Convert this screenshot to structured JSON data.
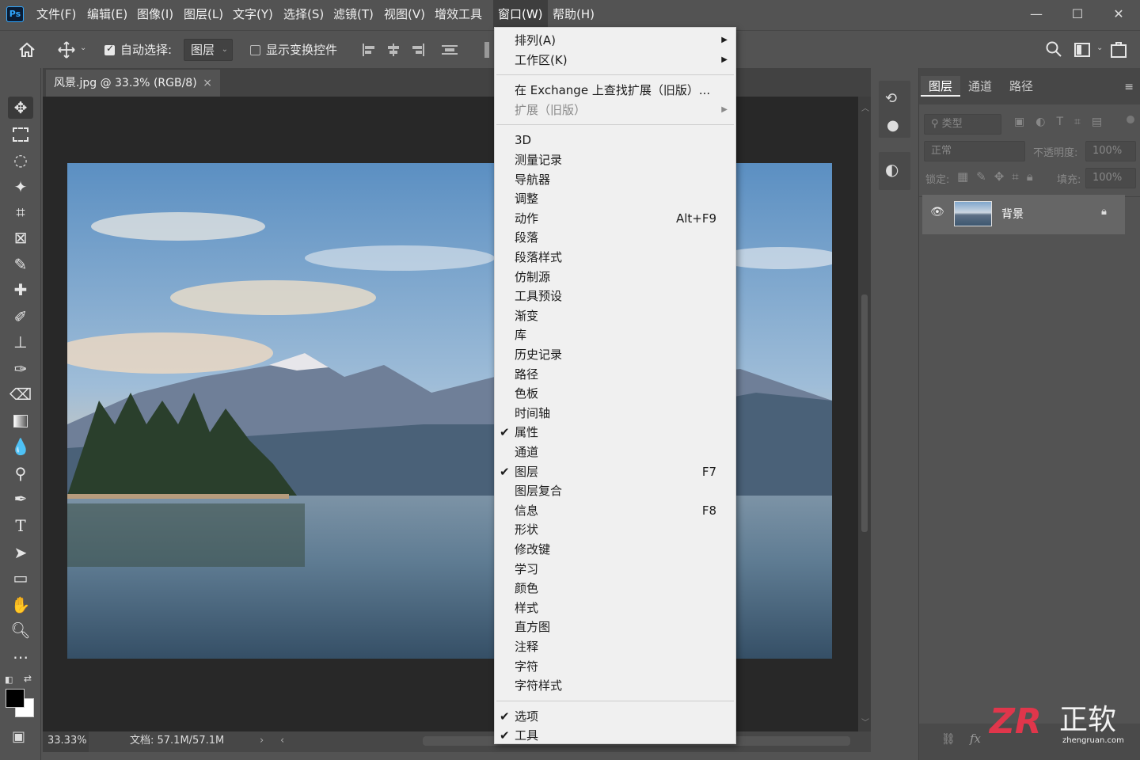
{
  "app": {
    "logo": "Ps"
  },
  "menubar": {
    "items": [
      "文件(F)",
      "编辑(E)",
      "图像(I)",
      "图层(L)",
      "文字(Y)",
      "选择(S)",
      "滤镜(T)",
      "视图(V)",
      "增效工具",
      "窗口(W)",
      "帮助(H)"
    ],
    "active_index": 9
  },
  "window_controls": {
    "minimize": "—",
    "maximize": "☐",
    "close": "✕"
  },
  "options": {
    "auto_select_label": "自动选择:",
    "auto_select_checked": true,
    "auto_select_target": "图层",
    "show_transform_label": "显示变换控件",
    "show_transform_checked": false
  },
  "document": {
    "tab_title": "风景.jpg @ 33.3% (RGB/8)",
    "tab_close": "×",
    "zoom": "33.33%",
    "doc_size": "文档: 57.1M/57.1M"
  },
  "panel": {
    "tabs": [
      "图层",
      "通道",
      "路径"
    ],
    "active_tab": 0,
    "filter_placeholder": "类型",
    "blend_mode": "正常",
    "opacity_label": "不透明度:",
    "opacity_value": "100%",
    "lock_label": "锁定:",
    "fill_label": "填充:",
    "fill_value": "100%",
    "layer_name": "背景"
  },
  "window_menu": {
    "items": [
      {
        "label": "排列(A)",
        "submenu": true
      },
      {
        "label": "工作区(K)",
        "submenu": true
      },
      {
        "sep": true
      },
      {
        "label": "在 Exchange 上查找扩展（旧版）..."
      },
      {
        "label": "扩展（旧版）",
        "submenu": true,
        "disabled": true
      },
      {
        "sep": true
      },
      {
        "label": "3D"
      },
      {
        "label": "测量记录"
      },
      {
        "label": "导航器"
      },
      {
        "label": "调整"
      },
      {
        "label": "动作",
        "shortcut": "Alt+F9"
      },
      {
        "label": "段落"
      },
      {
        "label": "段落样式"
      },
      {
        "label": "仿制源"
      },
      {
        "label": "工具预设"
      },
      {
        "label": "渐变"
      },
      {
        "label": "库"
      },
      {
        "label": "历史记录"
      },
      {
        "label": "路径"
      },
      {
        "label": "色板"
      },
      {
        "label": "时间轴"
      },
      {
        "label": "属性",
        "checked": true
      },
      {
        "label": "通道"
      },
      {
        "label": "图层",
        "checked": true,
        "shortcut": "F7"
      },
      {
        "label": "图层复合"
      },
      {
        "label": "信息",
        "shortcut": "F8"
      },
      {
        "label": "形状"
      },
      {
        "label": "修改键"
      },
      {
        "label": "学习"
      },
      {
        "label": "颜色"
      },
      {
        "label": "样式"
      },
      {
        "label": "直方图"
      },
      {
        "label": "注释"
      },
      {
        "label": "字符"
      },
      {
        "label": "字符样式"
      },
      {
        "sep": true
      },
      {
        "label": "选项",
        "checked": true
      },
      {
        "label": "工具",
        "checked": true
      }
    ]
  },
  "watermark": {
    "logo": "ZR",
    "brand": "正软",
    "url": "zhengruan.com"
  },
  "colors": {
    "accent": "#31a8ff",
    "menu_bg": "#f0f0f0",
    "ui_bg": "#535353"
  }
}
